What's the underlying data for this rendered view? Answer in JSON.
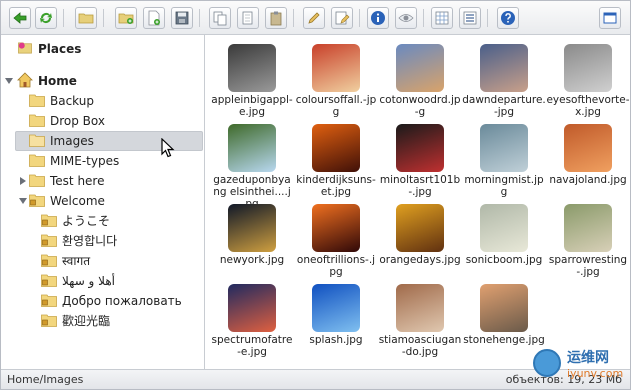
{
  "sidebar": {
    "places_label": "Places",
    "home_label": "Home",
    "items": [
      {
        "label": "Backup"
      },
      {
        "label": "Drop Box"
      },
      {
        "label": "Images"
      },
      {
        "label": "MIME-types"
      },
      {
        "label": "Test here"
      },
      {
        "label": "Welcome"
      },
      {
        "label": "ようこそ"
      },
      {
        "label": "환영합니다"
      },
      {
        "label": "स्वागत"
      },
      {
        "label": "أهلا و سهلا"
      },
      {
        "label": "Добро пожаловать"
      },
      {
        "label": "歡迎光臨"
      }
    ]
  },
  "files": [
    {
      "name": "appleinbigapple.jpg",
      "display": "appleinbigappl-e.jpg",
      "colors": [
        "#3a3a3a",
        "#9a9a9a"
      ]
    },
    {
      "name": "coloursoffall.jpg",
      "display": "coloursoffall.-jpg",
      "colors": [
        "#c8402a",
        "#f0d0a0"
      ]
    },
    {
      "name": "cotonwoodrd.jpg",
      "display": "cotonwoodrd.jp-g",
      "colors": [
        "#6a8ac0",
        "#d9a36a"
      ]
    },
    {
      "name": "dawndeparture.jpg",
      "display": "dawndeparture.-jpg",
      "colors": [
        "#4a5f8a",
        "#c9a08a"
      ]
    },
    {
      "name": "eyesofthevortex.jpg",
      "display": "eyesofthevorte-x.jpg",
      "colors": [
        "#8a8a8a",
        "#d0d0d0"
      ]
    },
    {
      "name": "gazeduponbyangelsintheir.jpg",
      "display": "gazeduponbyang elsinthei....jpg",
      "colors": [
        "#3f6a2a",
        "#b8d8f0"
      ]
    },
    {
      "name": "kinderdijksunset.jpg",
      "display": "kinderdijksuns-et.jpg",
      "colors": [
        "#e06010",
        "#401008"
      ]
    },
    {
      "name": "minoltasrt101b.jpg",
      "display": "minoltasrt101b-.jpg",
      "colors": [
        "#1a1a1a",
        "#c03030"
      ]
    },
    {
      "name": "morningmist.jpg",
      "display": "morningmist.jpg",
      "colors": [
        "#6a8a9a",
        "#c0d0d8"
      ]
    },
    {
      "name": "navajoland.jpg",
      "display": "navajoland.jpg",
      "colors": [
        "#c05a2a",
        "#f0a060"
      ]
    },
    {
      "name": "newyork.jpg",
      "display": "newyork.jpg",
      "colors": [
        "#101828",
        "#d0a040"
      ]
    },
    {
      "name": "oneoftrillions.jpg",
      "display": "oneoftrillions-.jpg",
      "colors": [
        "#f07020",
        "#300808"
      ]
    },
    {
      "name": "orangedays.jpg",
      "display": "orangedays.jpg",
      "colors": [
        "#e0a020",
        "#603010"
      ]
    },
    {
      "name": "sonicboom.jpg",
      "display": "sonicboom.jpg",
      "colors": [
        "#b0b8a8",
        "#e8e8d8"
      ]
    },
    {
      "name": "sparrowresting.jpg",
      "display": "sparrowresting-.jpg",
      "colors": [
        "#8a9a6a",
        "#d8d0b8"
      ]
    },
    {
      "name": "spectrumofatree.jpg",
      "display": "spectrumofatre-e.jpg",
      "colors": [
        "#202a60",
        "#e06040"
      ]
    },
    {
      "name": "splash.jpg",
      "display": "splash.jpg",
      "colors": [
        "#1050c0",
        "#80c0f0"
      ]
    },
    {
      "name": "stiamoasciugando.jpg",
      "display": "stiamoasciugan-do.jpg",
      "colors": [
        "#a06a4a",
        "#e0c8b0"
      ]
    },
    {
      "name": "stonehenge.jpg",
      "display": "stonehenge.jpg",
      "colors": [
        "#e0a070",
        "#6a5a4a"
      ]
    }
  ],
  "statusbar": {
    "path": "Home/Images",
    "info": "объектов: 19, 23 Мб"
  },
  "watermark": {
    "line1": "运维网",
    "line2": "iyunv.com"
  }
}
